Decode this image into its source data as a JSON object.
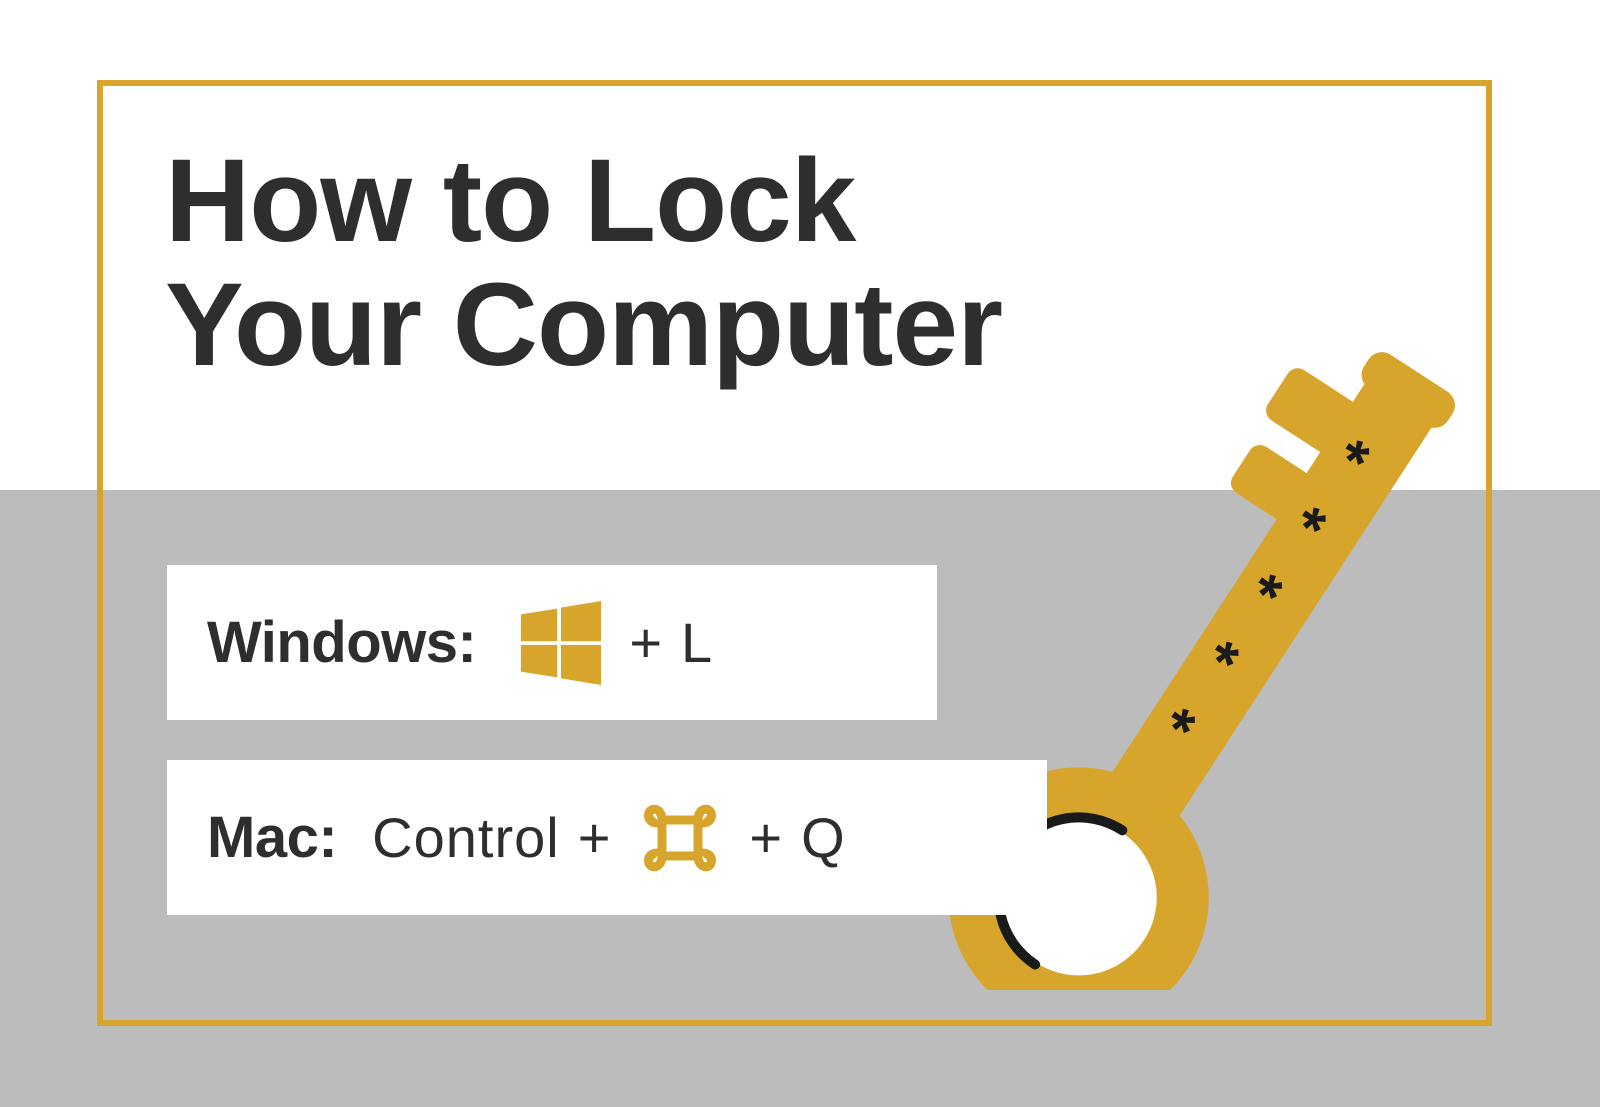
{
  "title": {
    "line1": "How to Lock",
    "line2": "Your Computer"
  },
  "shortcuts": {
    "windows": {
      "label": "Windows:",
      "plus": "+",
      "key": "L"
    },
    "mac": {
      "label": "Mac:",
      "control": "Control",
      "plus1": "+",
      "plus2": "+",
      "key": "Q"
    }
  },
  "colors": {
    "accent": "#d7a52b",
    "text": "#2e2e2e",
    "gray": "#bcbcbc"
  }
}
